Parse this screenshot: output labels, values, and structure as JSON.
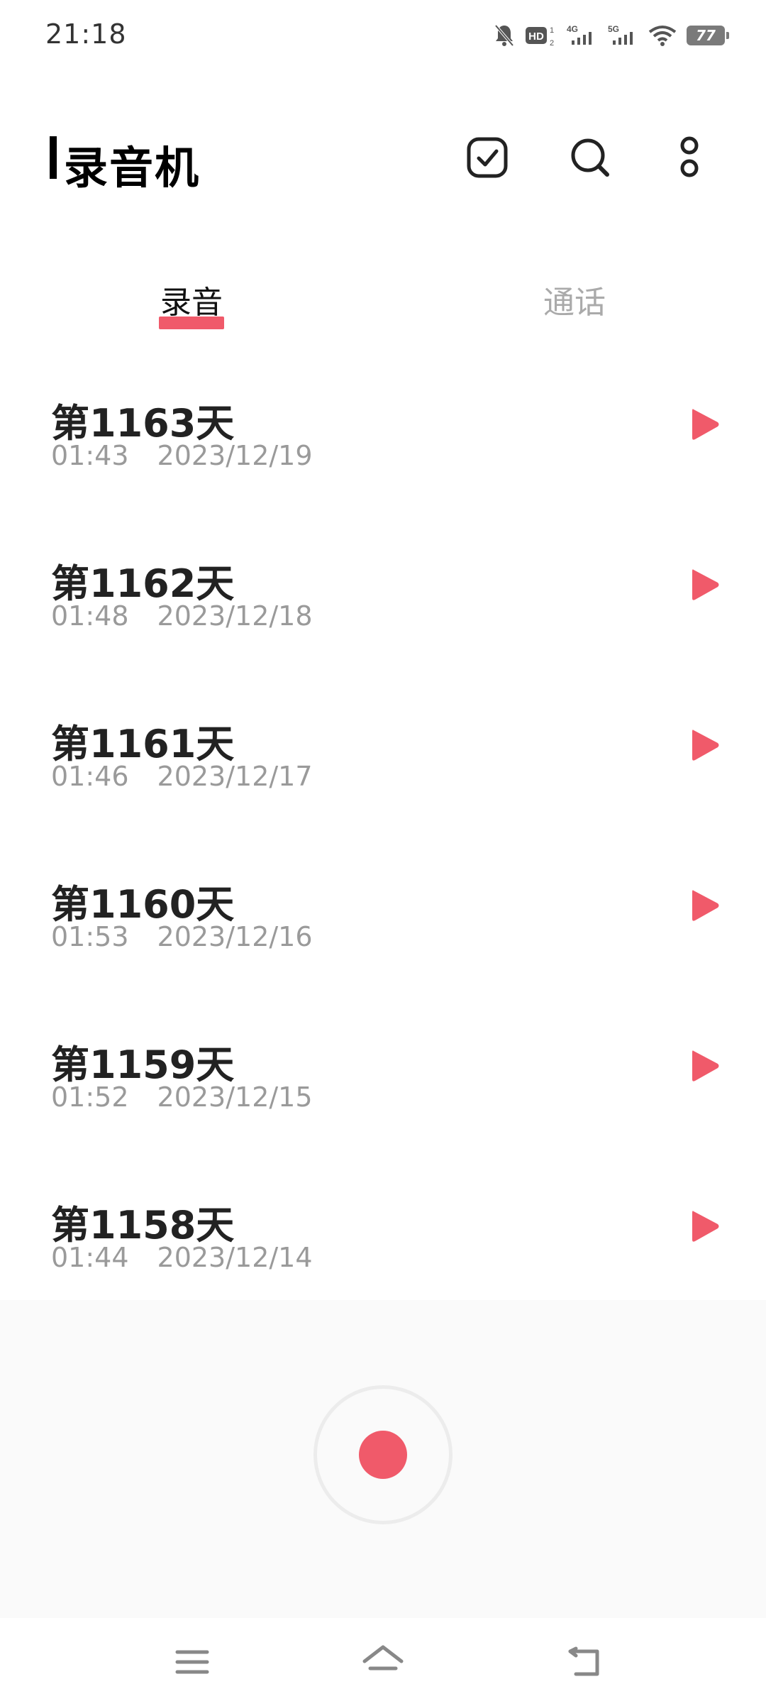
{
  "status_bar": {
    "time": "21:18",
    "network_4g": "4G",
    "network_5g": "5G",
    "battery": "77",
    "icons": [
      "mute-bell-icon",
      "hd-icon",
      "signal-4g-icon",
      "signal-5g-icon",
      "wifi-icon",
      "battery-icon"
    ]
  },
  "header": {
    "title": "录音机",
    "actions": [
      "select-check-icon",
      "search-icon",
      "more-icon"
    ]
  },
  "tabs": [
    {
      "label": "录音",
      "active": true
    },
    {
      "label": "通话",
      "active": false
    }
  ],
  "recordings": [
    {
      "title": "第1163天",
      "duration": "01:43",
      "date": "2023/12/19"
    },
    {
      "title": "第1162天",
      "duration": "01:48",
      "date": "2023/12/18"
    },
    {
      "title": "第1161天",
      "duration": "01:46",
      "date": "2023/12/17"
    },
    {
      "title": "第1160天",
      "duration": "01:53",
      "date": "2023/12/16"
    },
    {
      "title": "第1159天",
      "duration": "01:52",
      "date": "2023/12/15"
    },
    {
      "title": "第1158天",
      "duration": "01:44",
      "date": "2023/12/14"
    }
  ],
  "colors": {
    "accent": "#f05a6a",
    "text_primary": "#222222",
    "text_secondary": "#9a9a9a",
    "panel_bg": "#fafafa"
  },
  "nav": [
    "menu-icon",
    "home-icon",
    "back-icon"
  ]
}
